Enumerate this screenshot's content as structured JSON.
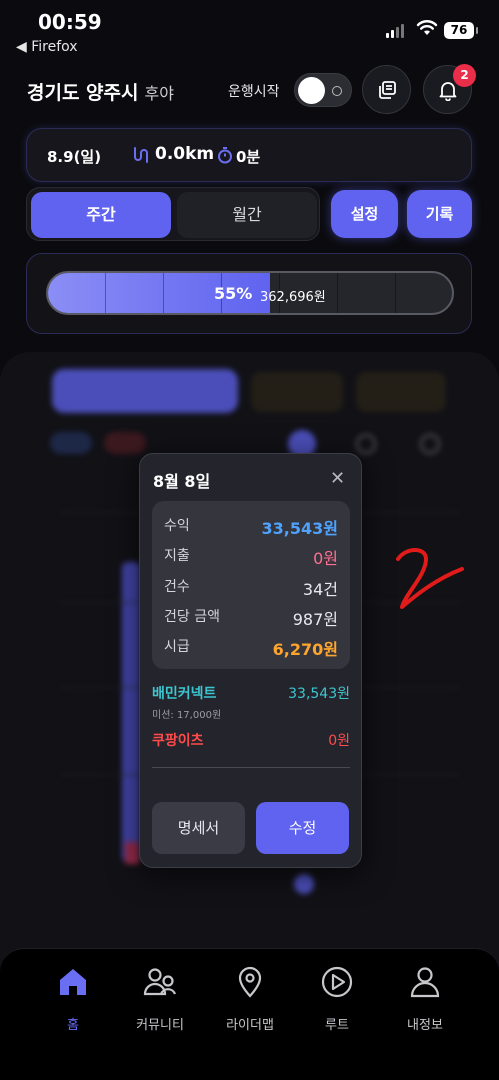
{
  "status_bar": {
    "time": "00:59",
    "back_label": "◀ Firefox",
    "battery": "76"
  },
  "header": {
    "region": "경기도 양주시",
    "region_sub": "후야",
    "drive_label": "운행시작",
    "notification_count": "2"
  },
  "summary": {
    "date": "8.9(일)",
    "distance": "0.0km",
    "minutes": "0분"
  },
  "tabs": {
    "week": "주간",
    "month": "월간",
    "settings": "설정",
    "records": "기록"
  },
  "progress": {
    "percent_label": "55%",
    "amount": "362,696원",
    "fraction": 0.55
  },
  "modal": {
    "title": "8월 8일",
    "close": "✕",
    "stats": [
      {
        "label": "수익",
        "value": "33,543원",
        "color": "#4fa3ff"
      },
      {
        "label": "지출",
        "value": "0원",
        "color": "#ff6f8f"
      },
      {
        "label": "건수",
        "value": "34건",
        "color": "#e8e8ee"
      },
      {
        "label": "건당 금액",
        "value": "987원",
        "color": "#e8e8ee"
      },
      {
        "label": "시급",
        "value": "6,270원",
        "color": "#ffa52e"
      }
    ],
    "platforms": [
      {
        "name": "배민커넥트",
        "value": "33,543원",
        "color": "#3dc6d0"
      },
      {
        "name": "쿠팡이츠",
        "value": "0원",
        "color": "#ff4b4b"
      }
    ],
    "mission": "미션: 17,000원",
    "statement_button": "명세서",
    "edit_button": "수정"
  },
  "nav": {
    "items": [
      {
        "label": "홈",
        "icon": "home-icon",
        "active": true
      },
      {
        "label": "커뮤니티",
        "icon": "community-icon",
        "active": false
      },
      {
        "label": "라이더맵",
        "icon": "map-pin-icon",
        "active": false
      },
      {
        "label": "루트",
        "icon": "play-circle-icon",
        "active": false
      },
      {
        "label": "내정보",
        "icon": "profile-icon",
        "active": false
      }
    ]
  },
  "colors": {
    "accent": "#5f63ef",
    "background": "#0b0b0f",
    "badge": "#ea2d48"
  }
}
